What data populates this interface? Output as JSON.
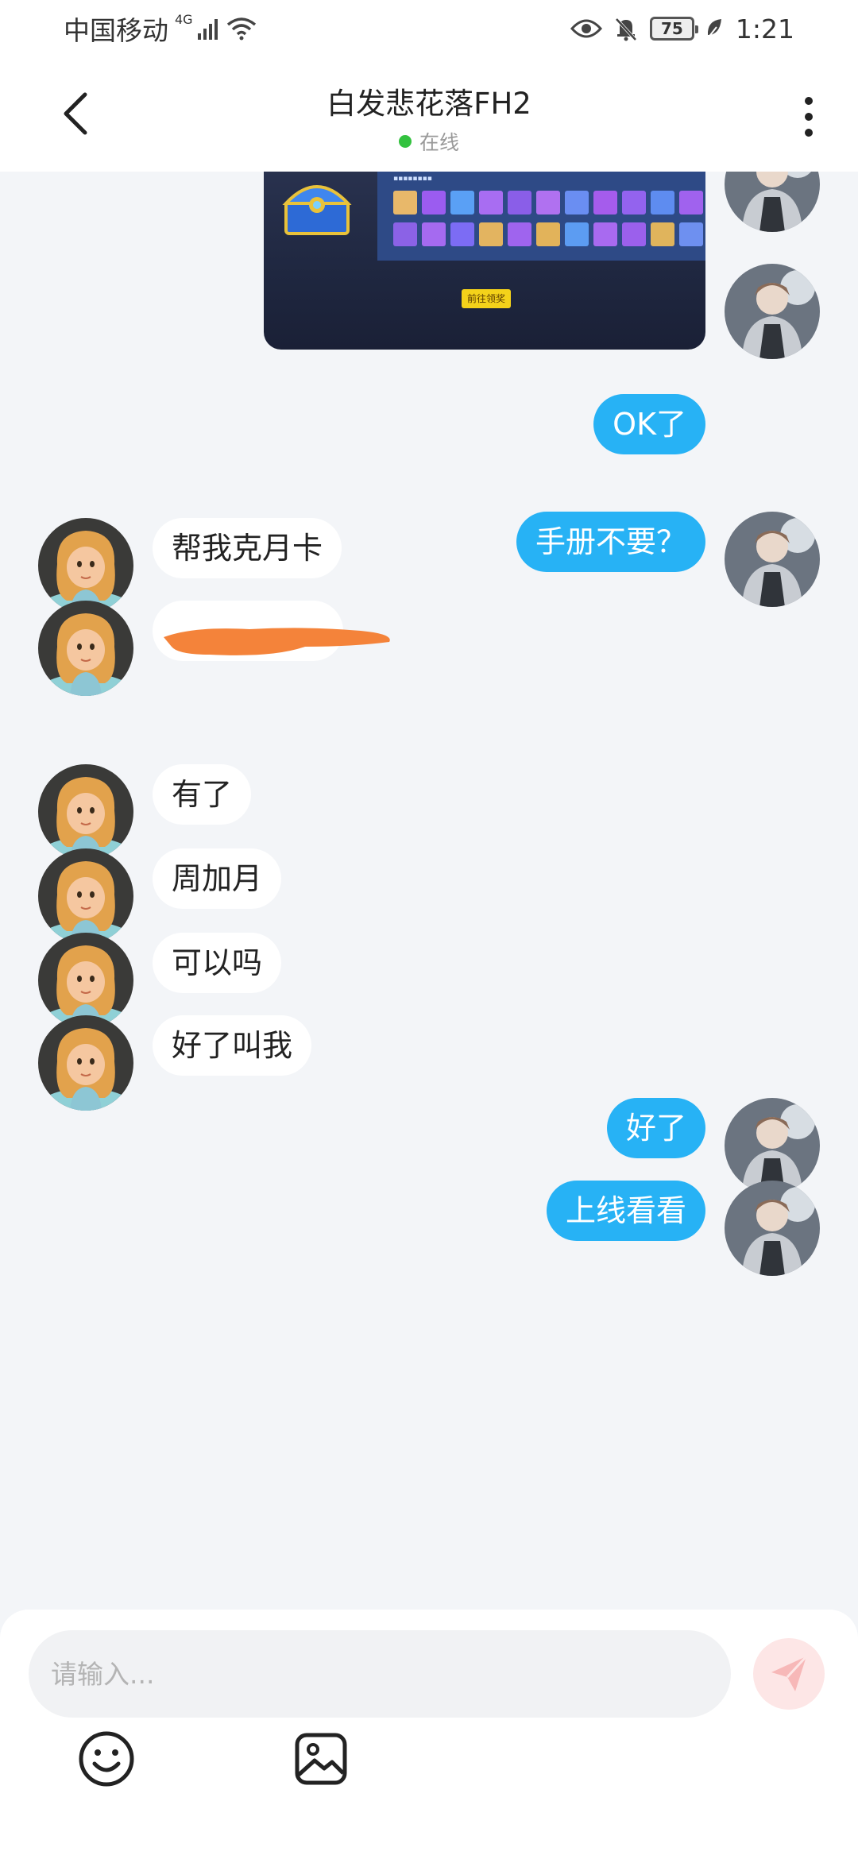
{
  "status_bar": {
    "carrier": "中国移动",
    "network": "4G",
    "battery": "75",
    "time": "1:21"
  },
  "header": {
    "title": "白发悲花落FH2",
    "status": "在线",
    "status_color": "#33c23f",
    "back_icon": "chevron-left-icon",
    "more_icon": "more-vertical-icon"
  },
  "messages": [
    {
      "side": "out",
      "type": "image"
    },
    {
      "side": "out",
      "text": "OK了"
    },
    {
      "side": "in",
      "text": "帮我克月卡"
    },
    {
      "side": "in",
      "text": "",
      "redacted": true
    },
    {
      "side": "out",
      "text": "手册不要？"
    },
    {
      "side": "in",
      "text": "有了"
    },
    {
      "side": "in",
      "text": "周加月"
    },
    {
      "side": "in",
      "text": "可以吗"
    },
    {
      "side": "in",
      "text": "好了叫我"
    },
    {
      "side": "out",
      "text": "好了"
    },
    {
      "side": "out",
      "text": "上线看看"
    }
  ],
  "shared_image": {
    "button_label": "前往领奖"
  },
  "input": {
    "placeholder": "请输入..."
  },
  "toolbar": {
    "emoji_icon": "smiley-icon",
    "image_icon": "image-icon",
    "send_icon": "send-icon"
  },
  "colors": {
    "outgoing_bubble": "#27b2f5",
    "incoming_bubble": "#ffffff",
    "background": "#f3f5f8",
    "send_button": "#fde6e6"
  }
}
